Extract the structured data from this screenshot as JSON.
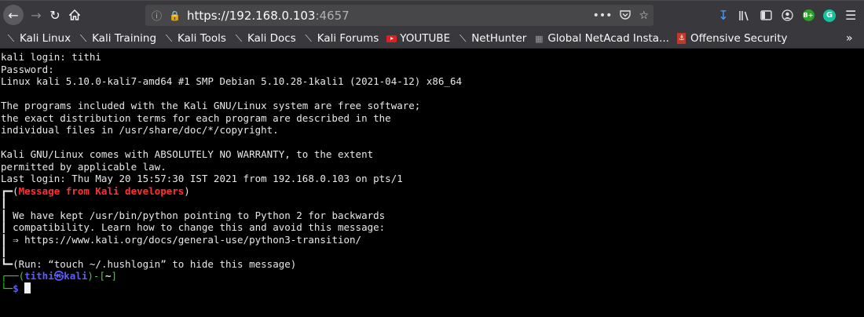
{
  "browser": {
    "url_host": "https://192.168.0.103",
    "url_port": ":4657"
  },
  "bookmarks": [
    {
      "label": "Kali Linux",
      "icon": "kali-dragon-icon"
    },
    {
      "label": "Kali Training",
      "icon": "kali-dragon-icon"
    },
    {
      "label": "Kali Tools",
      "icon": "kali-dragon-icon"
    },
    {
      "label": "Kali Docs",
      "icon": "kali-dragon-icon"
    },
    {
      "label": "Kali Forums",
      "icon": "kali-dragon-icon"
    },
    {
      "label": "YOUTUBE",
      "icon": "youtube-icon"
    },
    {
      "label": "NetHunter",
      "icon": "kali-dragon-icon"
    },
    {
      "label": "Global NetAcad Insta...",
      "icon": "netacad-icon"
    },
    {
      "label": "Offensive Security",
      "icon": "offsec-icon"
    }
  ],
  "terminal": {
    "lines": [
      "kali login: tithi",
      "Password:",
      "Linux kali 5.10.0-kali7-amd64 #1 SMP Debian 5.10.28-1kali1 (2021-04-12) x86_64",
      "",
      "The programs included with the Kali GNU/Linux system are free software;",
      "the exact distribution terms for each program are described in the",
      "individual files in /usr/share/doc/*/copyright.",
      "",
      "Kali GNU/Linux comes with ABSOLUTELY NO WARRANTY, to the extent",
      "permitted by applicable law.",
      "Last login: Thu May 20 15:57:30 IST 2021 from 192.168.0.103 on pts/1"
    ],
    "box_title": "Message from Kali developers",
    "box_lines": [
      "",
      "We have kept /usr/bin/python pointing to Python 2 for backwards",
      "compatibility. Learn how to change this and avoid this message:",
      "⇒ https://www.kali.org/docs/general-use/python3-transition/",
      ""
    ],
    "box_footer": "(Run: “touch ~/.hushlogin” to hide this message)",
    "prompt_user": "tithi㉿kali",
    "prompt_dir": "~",
    "prompt_symbol": "$"
  }
}
